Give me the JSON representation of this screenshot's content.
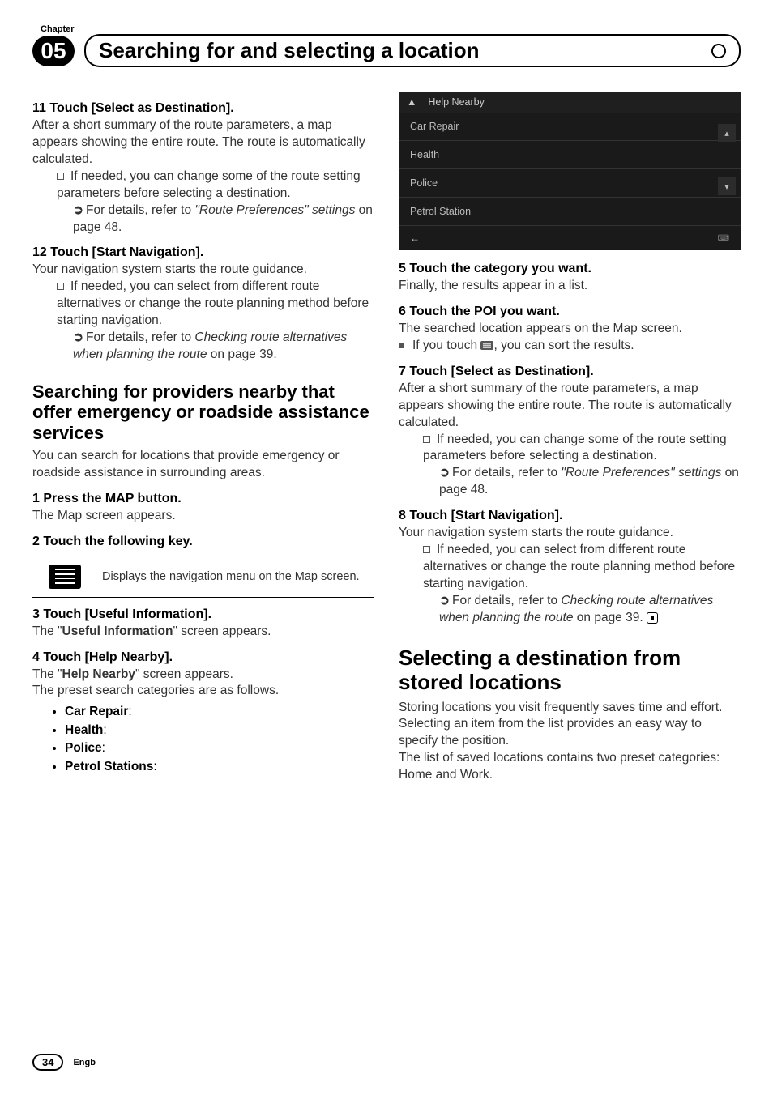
{
  "chapterLabel": "Chapter",
  "chapterNum": "05",
  "headerTitle": "Searching for and selecting a location",
  "left": {
    "step11_t": "11  Touch [Select as Destination].",
    "step11_b": "After a short summary of the route parameters, a map appears showing the entire route. The route is automatically calculated.",
    "step11_n1": "If needed, you can change some of the route setting parameters before selecting a destination.",
    "step11_ref_a": "For details, refer to ",
    "step11_ref_i": "\"Route Preferences\" settings",
    "step11_ref_b": " on page 48.",
    "step12_t": "12  Touch [Start Navigation].",
    "step12_b": "Your navigation system starts the route guidance.",
    "step12_n1": "If needed, you can select from different route alternatives or change the route planning method before starting navigation.",
    "step12_ref_a": "For details, refer to ",
    "step12_ref_i": "Checking route alternatives when planning the route",
    "step12_ref_b": " on page 39.",
    "h2": "Searching for providers nearby that offer emergency or roadside assistance services",
    "h2_body": "You can search for locations that provide emergency or roadside assistance in surrounding areas.",
    "s1_t": "1    Press the MAP button.",
    "s1_b": "The Map screen appears.",
    "s2_t": "2    Touch the following key.",
    "s2_desc": "Displays the navigation menu on the Map screen.",
    "s3_t": "3    Touch [Useful Information].",
    "s3_b_a": "The \"",
    "s3_b_strong": "Useful Information",
    "s3_b_b": "\" screen appears.",
    "s4_t": "4    Touch [Help Nearby].",
    "s4_b_a": "The \"",
    "s4_b_strong": "Help Nearby",
    "s4_b_b": "\" screen appears.",
    "s4_c": "The preset search categories are as follows.",
    "cat1": "Car Repair",
    "cat2": "Health",
    "cat3": "Police",
    "cat4": "Petrol Stations"
  },
  "screenshot": {
    "header": "Help Nearby",
    "rows": [
      "Car Repair",
      "Health",
      "Police",
      "Petrol Station"
    ]
  },
  "right": {
    "s5_t": "5    Touch the category you want.",
    "s5_b": "Finally, the results appear in a list.",
    "s6_t": "6    Touch the POI you want.",
    "s6_b": "The searched location appears on the Map screen.",
    "s6_n_a": "If you touch ",
    "s6_n_b": ", you can sort the results.",
    "s7_t": "7    Touch [Select as Destination].",
    "s7_b": "After a short summary of the route parameters, a map appears showing the entire route. The route is automatically calculated.",
    "s7_n1": "If needed, you can change some of the route setting parameters before selecting a destination.",
    "s7_ref_a": "For details, refer to ",
    "s7_ref_i": "\"Route Preferences\" settings",
    "s7_ref_b": " on page 48.",
    "s8_t": "8    Touch [Start Navigation].",
    "s8_b": "Your navigation system starts the route guidance.",
    "s8_n1": "If needed, you can select from different route alternatives or change the route planning method before starting navigation.",
    "s8_ref_a": "For details, refer to ",
    "s8_ref_i": "Checking route alternatives when planning the route",
    "s8_ref_b": " on page 39.",
    "h1": "Selecting a destination from stored locations",
    "h1_b1": "Storing locations you visit frequently saves time and effort.",
    "h1_b2": "Selecting an item from the list provides an easy way to specify the position.",
    "h1_b3": "The list of saved locations contains two preset categories: Home and Work."
  },
  "pageNum": "34",
  "lang": "Engb"
}
